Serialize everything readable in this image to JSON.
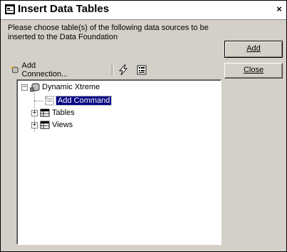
{
  "window": {
    "title": "Insert Data Tables",
    "close_glyph": "×"
  },
  "instructions": "Please choose table(s) of the following data sources to be inserted to the Data Foundation",
  "buttons": {
    "add_label": "Add",
    "close_label": "Close"
  },
  "toolbar": {
    "add_connection_label": "Add Connection...",
    "icons": [
      "add-connection-icon",
      "lightning-icon",
      "properties-icon"
    ]
  },
  "tree": {
    "root": {
      "label": "Dynamic Xtreme",
      "expanded": true
    },
    "items": [
      {
        "label": "Add Command",
        "selected": true,
        "icon": "command-icon"
      },
      {
        "label": "Tables",
        "expander": "+",
        "icon": "table-icon"
      },
      {
        "label": "Views",
        "expander": "+",
        "icon": "table-icon"
      }
    ]
  }
}
